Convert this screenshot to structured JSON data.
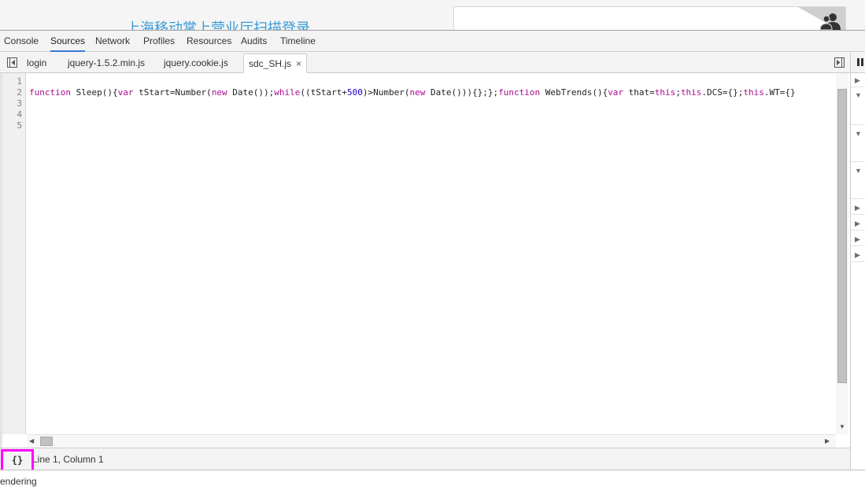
{
  "page": {
    "title": "上海移动掌上营业厅扫描登录",
    "icons": {
      "users": "users-icon"
    }
  },
  "devtools": {
    "panels": [
      {
        "label": "Console",
        "active": false
      },
      {
        "label": "Sources",
        "active": true
      },
      {
        "label": "Network",
        "active": false
      },
      {
        "label": "Profiles",
        "active": false
      },
      {
        "label": "Resources",
        "active": false
      },
      {
        "label": "Audits",
        "active": false
      },
      {
        "label": "Timeline",
        "active": false
      }
    ],
    "file_tabs": [
      {
        "label": "login",
        "active": false
      },
      {
        "label": "jquery-1.5.2.min.js",
        "active": false
      },
      {
        "label": "jquery.cookie.js",
        "active": false
      },
      {
        "label": "sdc_SH.js",
        "active": true,
        "close": "×"
      }
    ],
    "icons": {
      "navigator_toggle": "show-navigator-icon",
      "debugger_toggle": "show-debugger-icon",
      "pause": "pause-icon"
    }
  },
  "editor": {
    "line_numbers": [
      "1",
      "2",
      "3",
      "4",
      "5"
    ],
    "code_tokens": [
      {
        "t": "kw",
        "v": "function"
      },
      {
        "t": "plain",
        "v": " Sleep(){"
      },
      {
        "t": "kw",
        "v": "var"
      },
      {
        "t": "plain",
        "v": " tStart=Number("
      },
      {
        "t": "kw",
        "v": "new"
      },
      {
        "t": "plain",
        "v": " Date());"
      },
      {
        "t": "kw",
        "v": "while"
      },
      {
        "t": "plain",
        "v": "((tStart+"
      },
      {
        "t": "num",
        "v": "500"
      },
      {
        "t": "plain",
        "v": ")>Number("
      },
      {
        "t": "kw",
        "v": "new"
      },
      {
        "t": "plain",
        "v": " Date())){};};"
      },
      {
        "t": "kw",
        "v": "function"
      },
      {
        "t": "plain",
        "v": " WebTrends(){"
      },
      {
        "t": "kw",
        "v": "var"
      },
      {
        "t": "plain",
        "v": " that="
      },
      {
        "t": "kw",
        "v": "this"
      },
      {
        "t": "plain",
        "v": ";"
      },
      {
        "t": "kw",
        "v": "this"
      },
      {
        "t": "plain",
        "v": ".DCS={};"
      },
      {
        "t": "kw",
        "v": "this"
      },
      {
        "t": "plain",
        "v": ".WT={}"
      }
    ]
  },
  "status": {
    "pretty_print": "{}",
    "cursor": "Line 1, Column 1"
  },
  "drawer": {
    "text": "endering"
  },
  "colors": {
    "keyword": "#aa0d91",
    "number": "#1c00cf",
    "highlight_box": "#ff00ff",
    "active_tab_underline": "#3879d9"
  }
}
